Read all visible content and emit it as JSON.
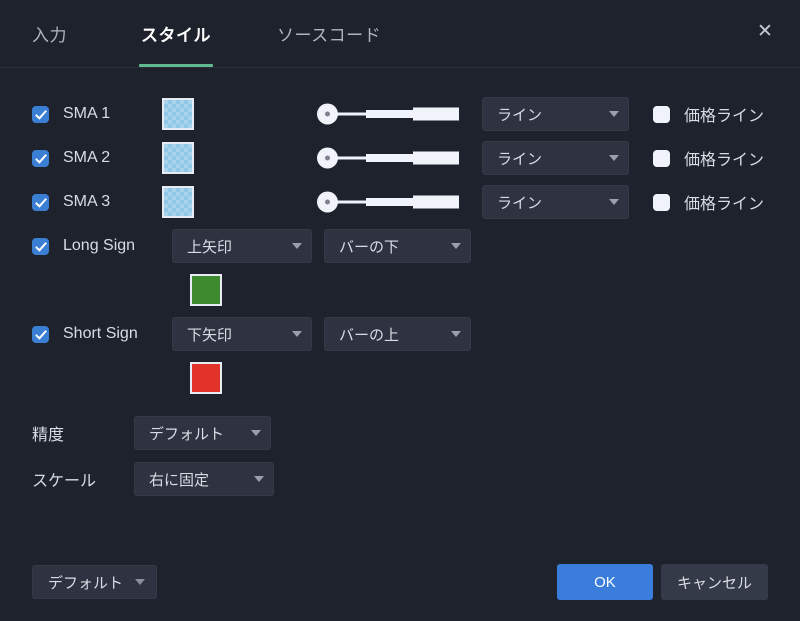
{
  "window": {
    "close_icon": "close-icon"
  },
  "tabs": [
    {
      "label": "入力",
      "active": false
    },
    {
      "label": "スタイル",
      "active": true
    },
    {
      "label": "ソースコード",
      "active": false
    }
  ],
  "colors": {
    "accent_green": "#61b98f",
    "checkbox_blue": "#3b7fd4",
    "primary_button": "#3a7ddb",
    "sma_swatch": "#a8d3ec",
    "long_swatch": "#3d8b2e",
    "short_swatch": "#e2332a",
    "panel_bg": "#1e222d",
    "control_bg": "#2f3341"
  },
  "sma_rows": [
    {
      "label": "SMA 1",
      "checked": true,
      "swatch_color": "#a8d3ec",
      "line_style": "ライン",
      "price_line_label": "価格ライン",
      "price_line_checked": false
    },
    {
      "label": "SMA 2",
      "checked": true,
      "swatch_color": "#a8d3ec",
      "line_style": "ライン",
      "price_line_label": "価格ライン",
      "price_line_checked": false
    },
    {
      "label": "SMA 3",
      "checked": true,
      "swatch_color": "#a8d3ec",
      "line_style": "ライン",
      "price_line_label": "価格ライン",
      "price_line_checked": false
    }
  ],
  "signs": [
    {
      "label": "Long Sign",
      "checked": true,
      "shape": "上矢印",
      "position": "バーの下",
      "swatch_color": "#3d8b2e"
    },
    {
      "label": "Short Sign",
      "checked": true,
      "shape": "下矢印",
      "position": "バーの上",
      "swatch_color": "#e2332a"
    }
  ],
  "preferences": [
    {
      "label": "精度",
      "value": "デフォルト"
    },
    {
      "label": "スケール",
      "value": "右に固定"
    }
  ],
  "footer": {
    "default_label": "デフォルト",
    "ok_label": "OK",
    "cancel_label": "キャンセル"
  }
}
